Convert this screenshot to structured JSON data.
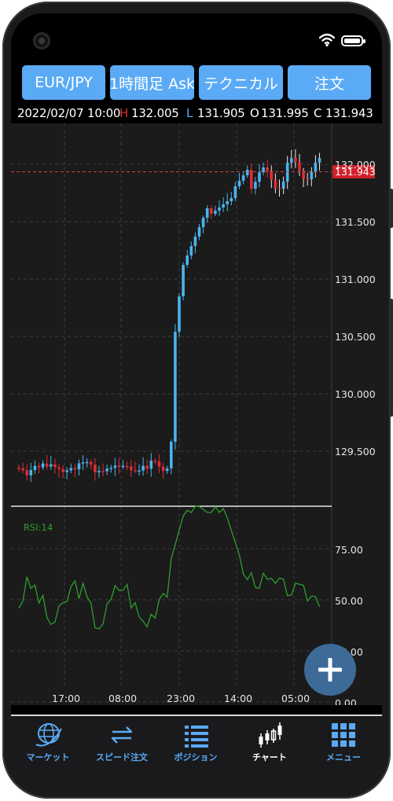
{
  "toolbar": {
    "symbol_label": "EUR/JPY",
    "timeframe_label": "1時間足 Ask",
    "technical_label": "テクニカル",
    "order_label": "注文"
  },
  "ohlc": {
    "datetime": "2022/02/07 10:00",
    "h_key": "H",
    "h_value": "132.005",
    "l_key": "L",
    "l_value": "131.905",
    "o_key": "O",
    "o_value": "131.995",
    "c_key": "C",
    "c_value": "131.943"
  },
  "price_axis": {
    "ticks": [
      "132.000",
      "131.500",
      "131.000",
      "130.500",
      "130.000",
      "129.500"
    ],
    "current_price": "131.943"
  },
  "rsi": {
    "label": "RSI:14",
    "ticks": [
      "75.00",
      "50.00",
      "25.00",
      "0.00"
    ]
  },
  "time_axis": {
    "ticks": [
      "17:00",
      "08:00",
      "23:00",
      "14:00",
      "05:00"
    ]
  },
  "tabs": [
    {
      "label": "マーケット",
      "icon": "globe-icon"
    },
    {
      "label": "スピード注文",
      "icon": "speed-order-icon"
    },
    {
      "label": "ポジション",
      "icon": "list-icon"
    },
    {
      "label": "チャート",
      "icon": "candlestick-icon"
    },
    {
      "label": "メニュー",
      "icon": "grid-menu-icon"
    }
  ],
  "colors": {
    "accent": "#5aaaf5",
    "bearish": "#e22a35",
    "bullish": "#4ab4ee",
    "rsi_line": "#2e9e2e",
    "current_price_bg": "#d0202b"
  },
  "fab": {
    "icon": "plus-icon"
  }
}
